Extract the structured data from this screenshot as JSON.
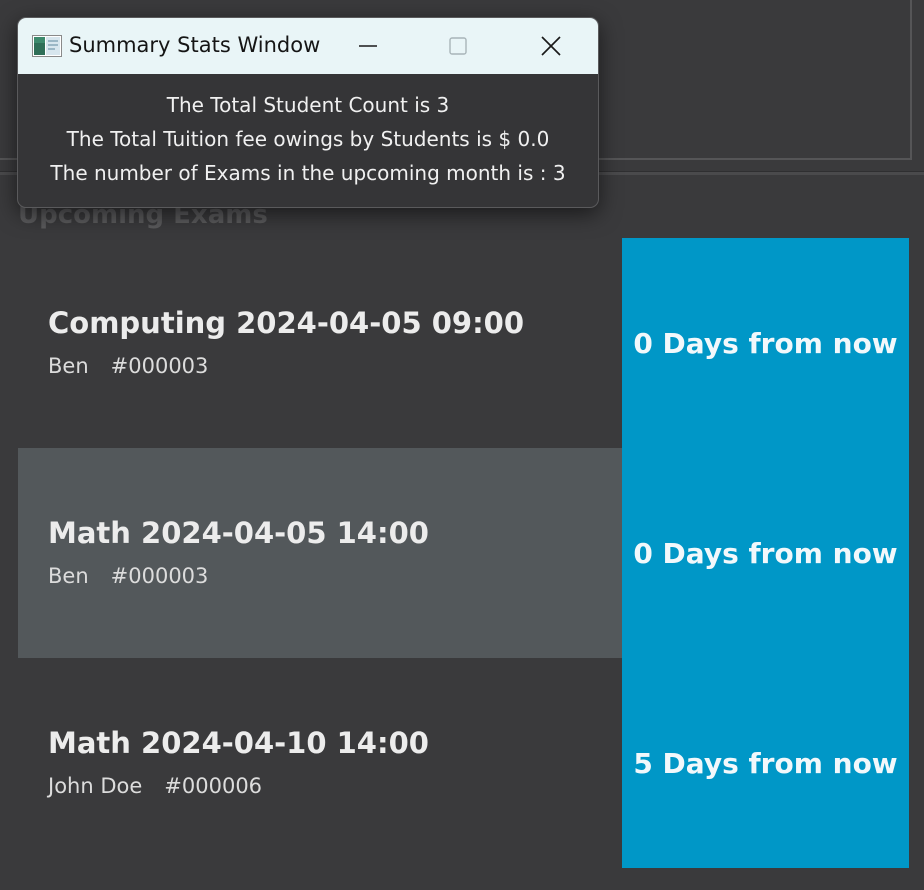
{
  "main": {
    "section_title": "Upcoming Exams",
    "exams": [
      {
        "title": "Computing 2024-04-05 09:00",
        "student": "Ben",
        "id": "#000003",
        "countdown": "0 Days from now"
      },
      {
        "title": "Math 2024-04-05 14:00",
        "student": "Ben",
        "id": "#000003",
        "countdown": "0 Days from now"
      },
      {
        "title": "Math 2024-04-10 14:00",
        "student": "John Doe",
        "id": "#000006",
        "countdown": "5 Days from now"
      }
    ]
  },
  "stats_window": {
    "title": "Summary Stats Window",
    "icon": "app-window-icon",
    "lines": [
      "The Total Student Count is 3",
      "The Total Tuition fee owings by Students is $ 0.0",
      "The number of Exams in the upcoming month is : 3"
    ]
  },
  "colors": {
    "background": "#3a3a3c",
    "card_highlight": "#53585b",
    "countdown_accent": "#0097c7",
    "title_bar": "#e9f5f7"
  }
}
